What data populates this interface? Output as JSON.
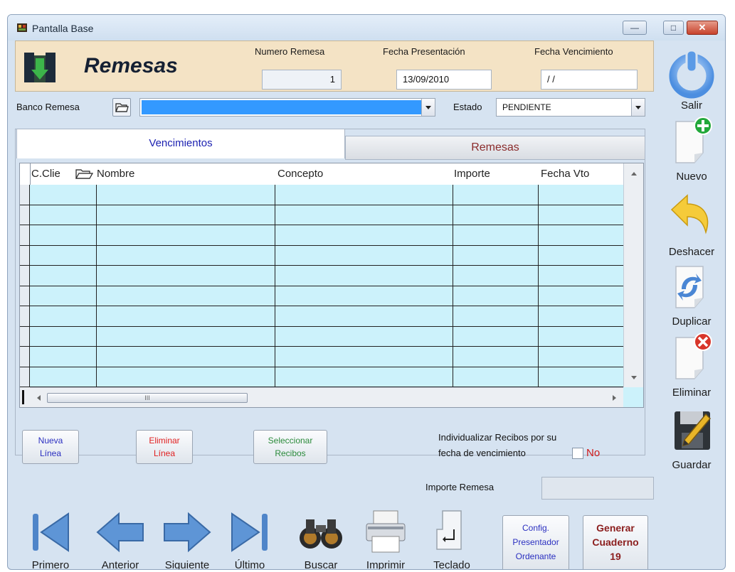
{
  "window": {
    "title": "Pantalla Base",
    "min_glyph": "—",
    "max_glyph": "□",
    "close_glyph": "✕"
  },
  "header": {
    "title": "Remesas",
    "numero_label": "Numero Remesa",
    "numero_value": "1",
    "fecha_pres_label": "Fecha Presentación",
    "fecha_pres_value": "13/09/2010",
    "fecha_venc_label": "Fecha Vencimiento",
    "fecha_venc_value": "/ /"
  },
  "filters": {
    "banco_label": "Banco Remesa",
    "banco_value": "",
    "estado_label": "Estado",
    "estado_value": "PENDIENTE"
  },
  "tabs": [
    {
      "label": "Vencimientos",
      "active": true
    },
    {
      "label": "Remesas",
      "active": false
    }
  ],
  "grid": {
    "columns": [
      "C.Clie",
      "Nombre",
      "Concepto",
      "Importe",
      "Fecha Vto"
    ],
    "rows": [],
    "hscroll_marker": "III"
  },
  "grid_buttons": {
    "nueva_line1": "Nueva",
    "nueva_line2": "Línea",
    "eliminar_line1": "Eliminar",
    "eliminar_line2": "Línea",
    "seleccionar_line1": "Seleccionar",
    "seleccionar_line2": "Recibos"
  },
  "individualizar": {
    "line1": "Individualizar Recibos por su",
    "line2": "fecha de vencimiento",
    "check_label": "No",
    "checked": false
  },
  "importe_remesa": {
    "label": "Importe Remesa",
    "value": ""
  },
  "nav": {
    "primero": "Primero",
    "anterior": "Anterior",
    "siguiente": "Siguiente",
    "ultimo": "Último",
    "buscar": "Buscar",
    "imprimir": "Imprimir",
    "teclado": "Teclado"
  },
  "config_button": {
    "line1": "Config.",
    "line2": "Presentador",
    "line3": "Ordenante"
  },
  "generar_button": {
    "line1": "Generar",
    "line2": "Cuaderno",
    "line3": "19"
  },
  "sidebar": {
    "salir": "Salir",
    "nuevo": "Nuevo",
    "deshacer": "Deshacer",
    "duplicar": "Duplicar",
    "eliminar": "Eliminar",
    "guardar": "Guardar"
  },
  "colors": {
    "grid_body": "#ccf2fb",
    "header_panel": "#f4e3c5",
    "combo_selected": "#3399ff",
    "window_bg": "#d6e3f1"
  }
}
